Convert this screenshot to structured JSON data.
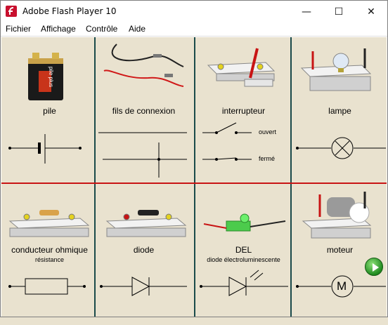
{
  "window": {
    "title": "Adobe Flash Player 10"
  },
  "titlebar": {
    "minimize_glyph": "—",
    "maximize_glyph": "☐",
    "close_glyph": "✕"
  },
  "menu": [
    {
      "label": "Fichier"
    },
    {
      "label": "Affichage"
    },
    {
      "label": "Contrôle"
    },
    {
      "label": "Aide"
    }
  ],
  "components": [
    {
      "label": "pile"
    },
    {
      "label": "fils de connexion"
    },
    {
      "label": "interrupteur",
      "states": [
        "ouvert",
        "fermé"
      ]
    },
    {
      "label": "lampe"
    },
    {
      "label": "conducteur ohmique",
      "sub": "résistance"
    },
    {
      "label": "diode"
    },
    {
      "label": "DEL",
      "sub": "diode électroluminescente"
    },
    {
      "label": "moteur",
      "symbol": "M"
    }
  ],
  "battery": {
    "brand_text": "pile plus"
  },
  "colors": {
    "background": "#e9e2cf",
    "grid_vertical": "#1a4a4a",
    "grid_horizontal": "#c81414",
    "next_button": "#1f8a1f"
  },
  "icons": {
    "app": "flash-icon",
    "next": "next-arrow-icon"
  }
}
